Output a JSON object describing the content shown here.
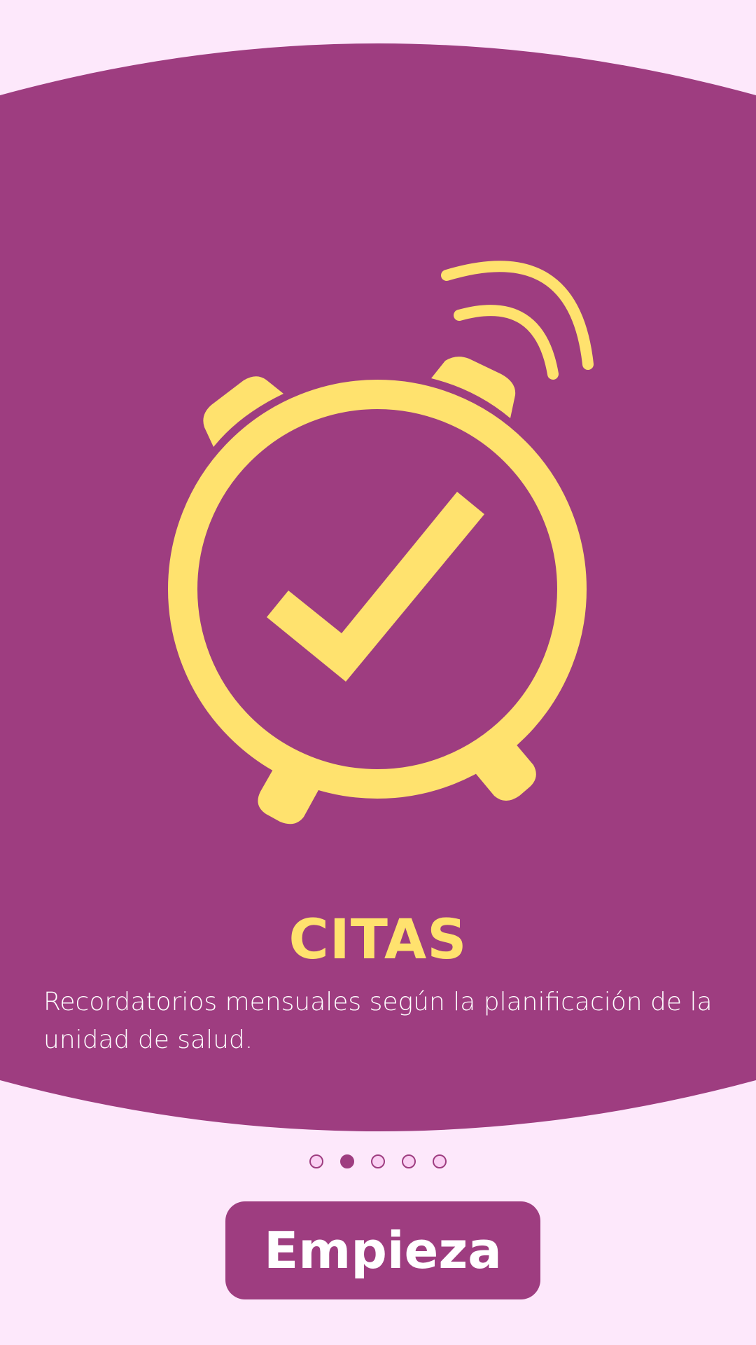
{
  "colors": {
    "background": "#FDE8FB",
    "panel": "#9E3D80",
    "accent": "#FFE26E",
    "text_light": "#FFFFFF",
    "dot_inactive": "#FAD0F3"
  },
  "illustration": {
    "icon": "alarm-clock-check-icon"
  },
  "slide": {
    "title": "CITAS",
    "description": "Recordatorios mensuales según la planificación de la unidad de salud."
  },
  "pager": {
    "count": 5,
    "active_index": 1
  },
  "start_button": {
    "label": "Empieza"
  }
}
